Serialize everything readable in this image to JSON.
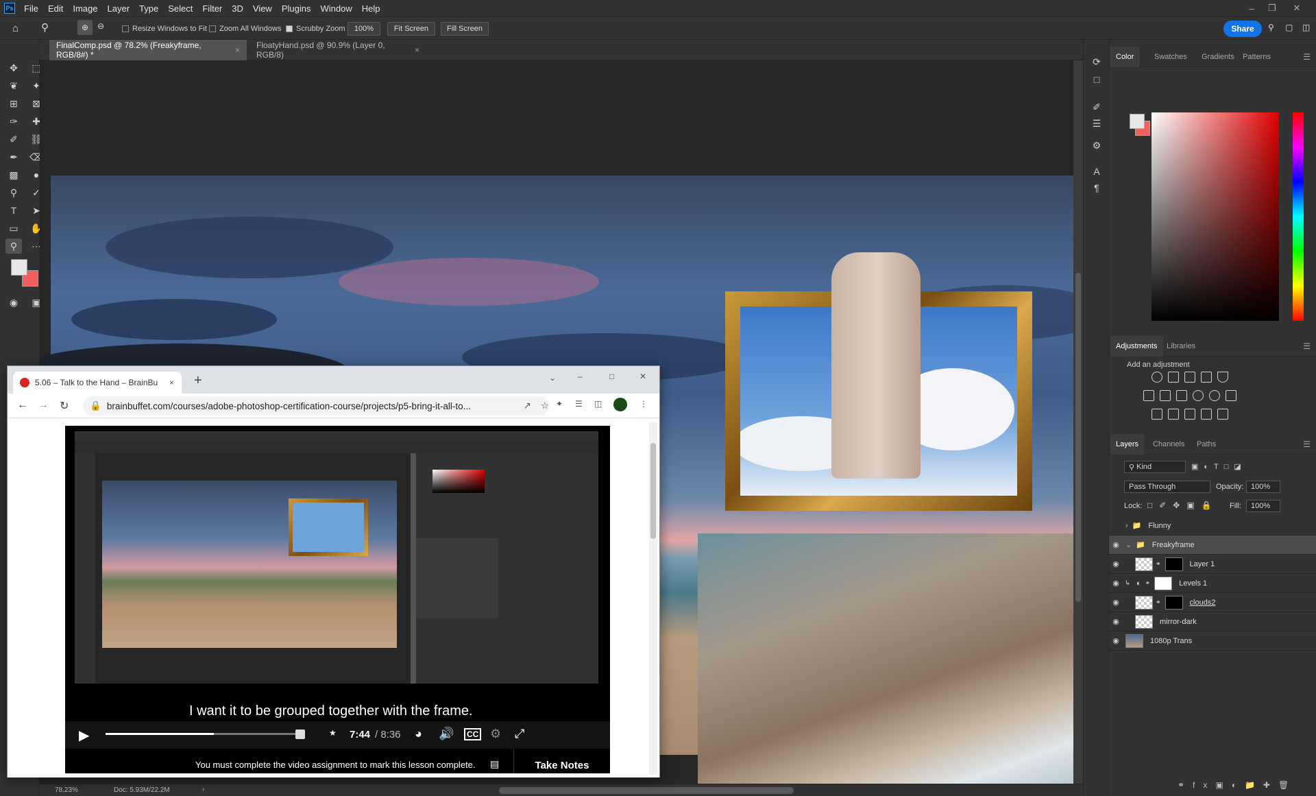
{
  "app": {
    "logo": "Ps",
    "menu": [
      "File",
      "Edit",
      "Image",
      "Layer",
      "Type",
      "Select",
      "Filter",
      "3D",
      "View",
      "Plugins",
      "Window",
      "Help"
    ]
  },
  "options_bar": {
    "resize_windows": "Resize Windows to Fit",
    "zoom_all": "Zoom All Windows",
    "scrubby_zoom": "Scrubby Zoom",
    "zoom_value": "100%",
    "fit_screen": "Fit Screen",
    "fill_screen": "Fill Screen",
    "share": "Share"
  },
  "doc_tabs": [
    {
      "label": "FinalComp.psd @ 78.2% (Freakyframe, RGB/8#) *"
    },
    {
      "label": "FloatyHand.psd @ 90.9% (Layer 0, RGB/8)"
    }
  ],
  "status": {
    "zoom": "78.23%",
    "doc": "Doc: 5.93M/22.2M"
  },
  "color_panel": {
    "tabs": [
      "Color",
      "Swatches",
      "Gradients",
      "Patterns"
    ],
    "fg_color": "#e8e8e8",
    "bg_color": "#f06060"
  },
  "adjustments_panel": {
    "tabs": [
      "Adjustments",
      "Libraries"
    ],
    "hint": "Add an adjustment"
  },
  "layers_panel": {
    "tabs": [
      "Layers",
      "Channels",
      "Paths"
    ],
    "filter": "Kind",
    "blend_mode": "Pass Through",
    "opacity_label": "Opacity:",
    "opacity": "100%",
    "lock_label": "Lock:",
    "fill_label": "Fill:",
    "fill": "100%",
    "layers": [
      {
        "name": "Flunny",
        "type": "group"
      },
      {
        "name": "Freakyframe",
        "type": "group"
      },
      {
        "name": "Layer 1",
        "type": "layer"
      },
      {
        "name": "Levels 1",
        "type": "adjustment"
      },
      {
        "name": "clouds2",
        "type": "layer"
      },
      {
        "name": "mirror-dark",
        "type": "layer"
      },
      {
        "name": "1080p Trans",
        "type": "layer"
      }
    ]
  },
  "browser": {
    "tab_title": "5.06 – Talk to the Hand – BrainBu",
    "url": "brainbuffet.com/courses/adobe-photoshop-certification-course/projects/p5-bring-it-all-to...",
    "video": {
      "caption": "I want it to be grouped together with the frame.",
      "time_current": "7:44",
      "time_total": "/ 8:36",
      "progress": 0.55,
      "cc": "CC",
      "completion_msg": "You must complete the video assignment to mark this lesson complete.",
      "take_notes": "Take Notes"
    }
  }
}
